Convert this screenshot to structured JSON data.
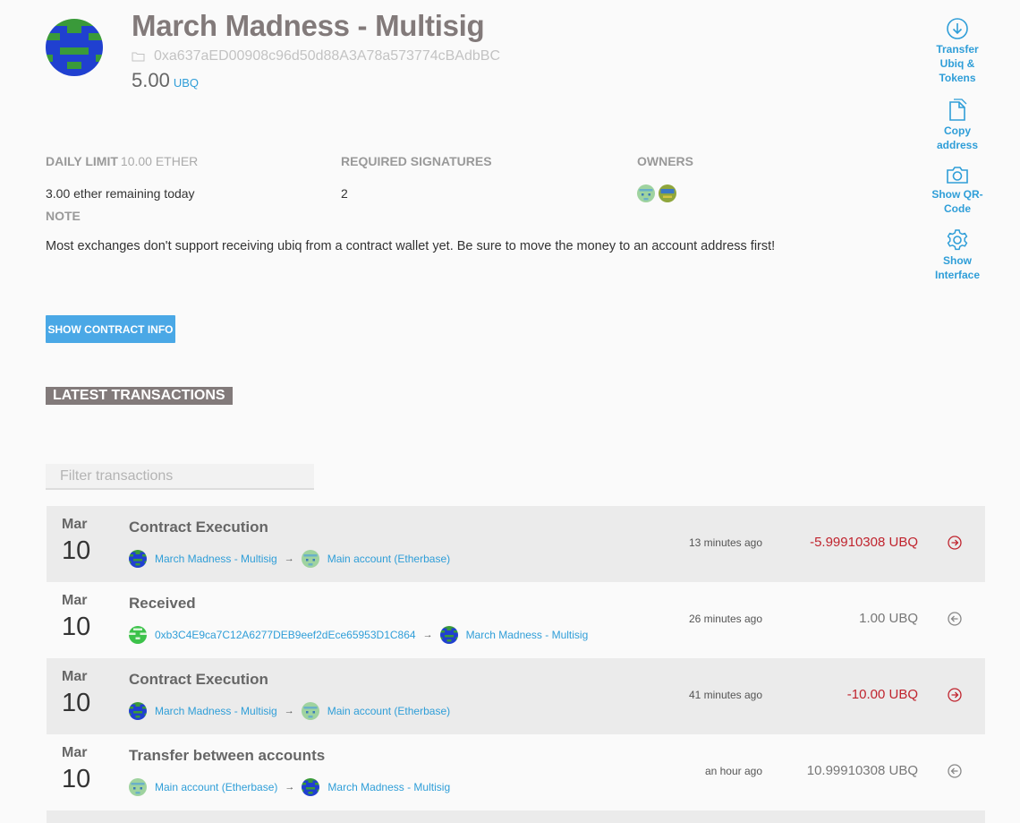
{
  "header": {
    "title": "March Madness - Multisig",
    "address": "0xa637aED00908c96d50d88A3A78a573774cBAdbBC",
    "balance": "5.00",
    "balance_unit": "UBQ"
  },
  "actions": {
    "transfer": "Transfer Ubiq & Tokens",
    "copy": "Copy address",
    "qr": "Show QR-Code",
    "interface": "Show Interface"
  },
  "stats": {
    "daily_limit_label": "DAILY LIMIT",
    "daily_limit_value": "10.00 ETHER",
    "daily_limit_remaining": "3.00 ether remaining today",
    "required_sigs_label": "REQUIRED SIGNATURES",
    "required_sigs_value": "2",
    "owners_label": "OWNERS",
    "note_label": "NOTE",
    "note_text": "Most exchanges don't support receiving ubiq from a contract wallet yet. Be sure to move the money to an account address first!"
  },
  "buttons": {
    "contract_info": "SHOW CONTRACT INFO"
  },
  "transactions": {
    "section_title": "LATEST TRANSACTIONS",
    "filter_placeholder": "Filter transactions",
    "rows": [
      {
        "month": "Mar",
        "day": "10",
        "title": "Contract Execution",
        "from": "March Madness - Multisig",
        "to": "Main account (Etherbase)",
        "time": "13 minutes ago",
        "amount": "-5.99910308 UBQ",
        "direction": "out"
      },
      {
        "month": "Mar",
        "day": "10",
        "title": "Received",
        "from": "0xb3C4E9ca7C12A6277DEB9eef2dEce65953D1C864",
        "to": "March Madness - Multisig",
        "time": "26 minutes ago",
        "amount": "1.00 UBQ",
        "direction": "in"
      },
      {
        "month": "Mar",
        "day": "10",
        "title": "Contract Execution",
        "from": "March Madness - Multisig",
        "to": "Main account (Etherbase)",
        "time": "41 minutes ago",
        "amount": "-10.00 UBQ",
        "direction": "out"
      },
      {
        "month": "Mar",
        "day": "10",
        "title": "Transfer between accounts",
        "from": "Main account (Etherbase)",
        "to": "March Madness - Multisig",
        "time": "an hour ago",
        "amount": "10.99910308 UBQ",
        "direction": "in"
      }
    ]
  },
  "colors": {
    "accent": "#2f9ed8",
    "negative": "#c0242e",
    "title": "#827a7a"
  }
}
